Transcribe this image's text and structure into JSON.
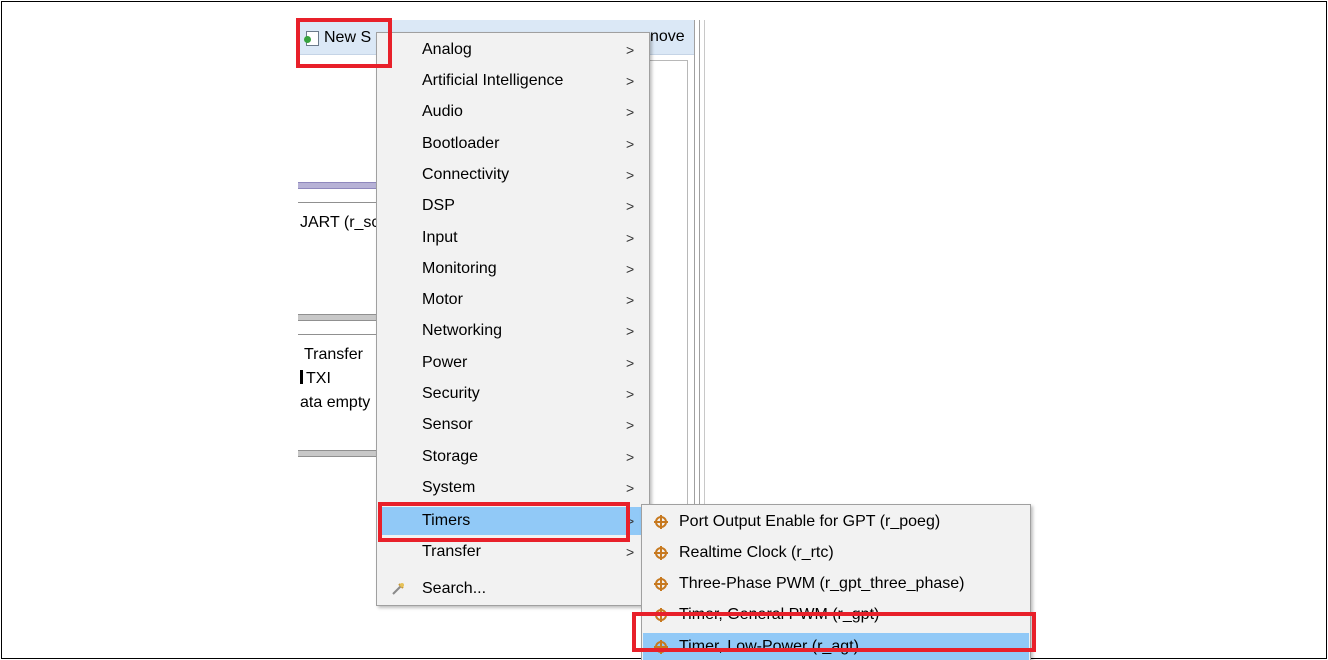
{
  "toolbar": {
    "new_label": "New S",
    "remove_label": "nove"
  },
  "background": {
    "uart_text": "JART (r_sc",
    "transfer_text": "Transfer",
    "txi_text": "TXI",
    "data_empty_text": "ata empty"
  },
  "menu": {
    "items": [
      {
        "label": "Analog"
      },
      {
        "label": "Artificial Intelligence"
      },
      {
        "label": "Audio"
      },
      {
        "label": "Bootloader"
      },
      {
        "label": "Connectivity"
      },
      {
        "label": "DSP"
      },
      {
        "label": "Input"
      },
      {
        "label": "Monitoring"
      },
      {
        "label": "Motor"
      },
      {
        "label": "Networking"
      },
      {
        "label": "Power"
      },
      {
        "label": "Security"
      },
      {
        "label": "Sensor"
      },
      {
        "label": "Storage"
      },
      {
        "label": "System"
      },
      {
        "label": "Timers"
      },
      {
        "label": "Transfer"
      }
    ],
    "search_label": "Search...",
    "arrow": ">",
    "selected": "Timers"
  },
  "submenu": {
    "items": [
      {
        "label": "Port Output Enable for GPT (r_poeg)"
      },
      {
        "label": "Realtime Clock (r_rtc)"
      },
      {
        "label": "Three-Phase PWM (r_gpt_three_phase)"
      },
      {
        "label": "Timer, General PWM (r_gpt)"
      },
      {
        "label": "Timer, Low-Power (r_agt)"
      }
    ],
    "selected": "Timer, Low-Power (r_agt)",
    "icon": "component-icon"
  },
  "colors": {
    "highlight": "#91c9f7",
    "menu_bg": "#f2f2f2",
    "annotation_red": "#e8202a",
    "toolbar_bg": "#dbe8f6"
  }
}
